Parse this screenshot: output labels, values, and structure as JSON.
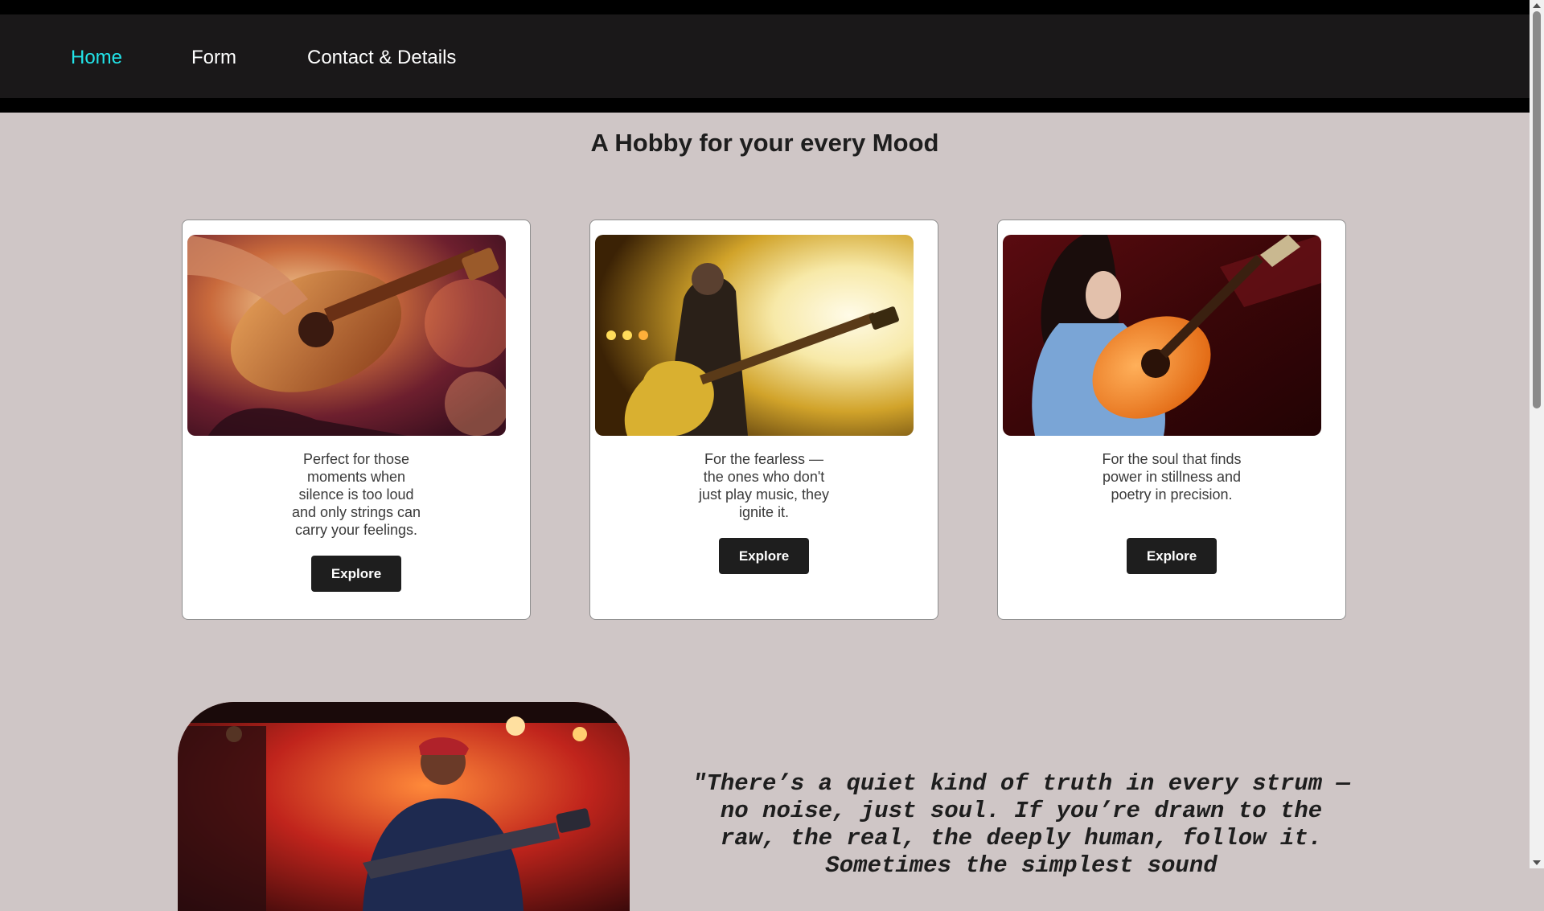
{
  "nav": {
    "home": "Home",
    "form": "Form",
    "contact": "Contact & Details",
    "active_color": "#22e3e8"
  },
  "page_title": "A Hobby for your every Mood",
  "cards": [
    {
      "image": "acoustic-guitar-photo",
      "description": "Perfect for those moments when silence is too loud and only strings can carry your feelings.",
      "button": "Explore"
    },
    {
      "image": "electric-guitar-concert-photo",
      "description": "For the fearless — the ones who don't just play music, they ignite it.",
      "button": "Explore"
    },
    {
      "image": "classical-guitar-photo",
      "description": "For the soul that finds power in stillness and poetry in precision.",
      "button": "Explore"
    }
  ],
  "feature": {
    "image": "stage-singer-guitar-photo",
    "quote": "\"There’s a quiet kind of truth in every strum — no noise, just soul. If you’re drawn to the raw, the real, the deeply human, follow it. Sometimes the simplest sound"
  },
  "colors": {
    "background": "#cfc6c6",
    "navbar": "#1a1819",
    "button": "#1e1e1e"
  }
}
